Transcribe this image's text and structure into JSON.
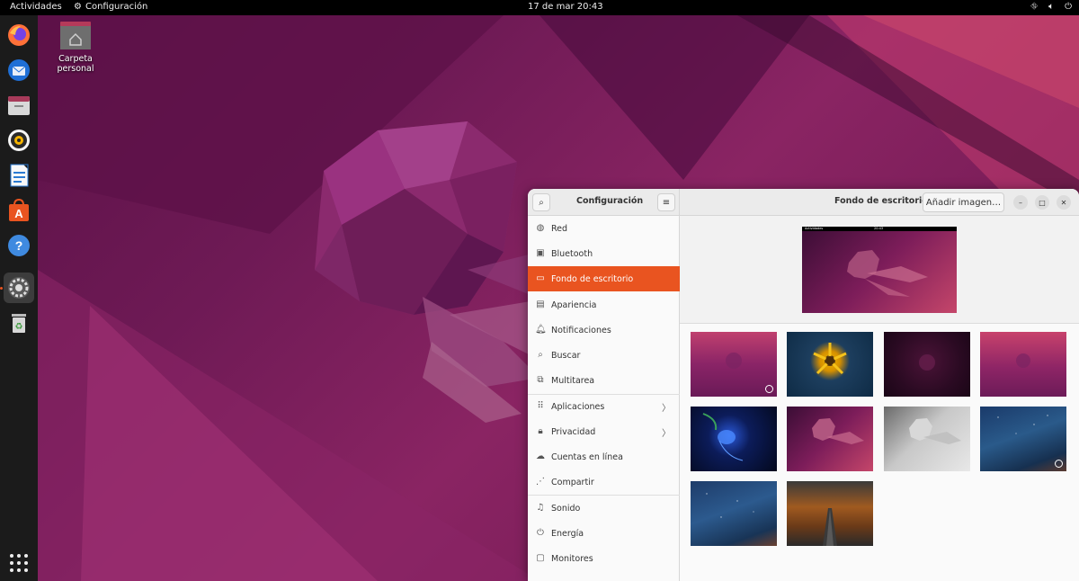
{
  "topbar": {
    "activities": "Actividades",
    "app_name": "Configuración",
    "clock": "17 de mar  20:43"
  },
  "desktop": {
    "home_label": "Carpeta personal"
  },
  "dock": {
    "items": [
      "firefox-icon",
      "thunderbird-icon",
      "files-icon",
      "rhythmbox-icon",
      "libreoffice-writer-icon",
      "software-icon",
      "help-icon",
      "settings-icon",
      "trash-icon"
    ],
    "show_apps": "app-grid-icon"
  },
  "window": {
    "sidebar_title": "Configuración",
    "main_title": "Fondo de escritorio",
    "add_image": "Añadir imagen…",
    "preview_topbar_left": "Actividades",
    "preview_topbar_clock": "20:43"
  },
  "sidebar": {
    "items": [
      {
        "label": "Red",
        "icon": "network-icon"
      },
      {
        "label": "Bluetooth",
        "icon": "bluetooth-icon"
      },
      {
        "label": "Fondo de escritorio",
        "icon": "background-icon",
        "selected": true
      },
      {
        "label": "Apariencia",
        "icon": "appearance-icon"
      },
      {
        "label": "Notificaciones",
        "icon": "bell-icon"
      },
      {
        "label": "Buscar",
        "icon": "search-icon"
      },
      {
        "label": "Multitarea",
        "icon": "multitask-icon"
      },
      {
        "label": "Aplicaciones",
        "icon": "apps-icon"
      },
      {
        "label": "Privacidad",
        "icon": "lock-icon"
      },
      {
        "label": "Cuentas en línea",
        "icon": "cloud-icon"
      },
      {
        "label": "Compartir",
        "icon": "share-icon"
      },
      {
        "label": "Sonido",
        "icon": "music-icon"
      },
      {
        "label": "Energía",
        "icon": "power-icon"
      },
      {
        "label": "Monitores",
        "icon": "monitor-icon"
      }
    ]
  },
  "colors": {
    "accent": "#e95420",
    "dock": "#1b1b1b",
    "topbar": "#000000"
  }
}
